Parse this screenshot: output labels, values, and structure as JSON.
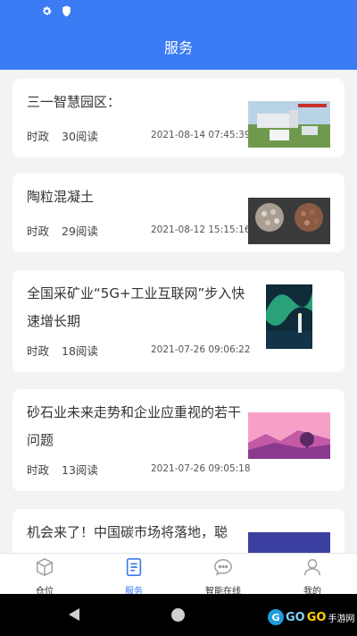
{
  "header": {
    "title": "服务"
  },
  "status_icons": [
    "gear-icon",
    "shield-icon"
  ],
  "articles": [
    {
      "title": "三一智慧园区：",
      "category": "时政",
      "reads": "30阅读",
      "date": "2021-08-14 07:45:39",
      "thumb": "industrial-park-photo"
    },
    {
      "title": "陶粒混凝土",
      "category": "时政",
      "reads": "29阅读",
      "date": "2021-08-12 15:15:16",
      "thumb": "ceramsite-photo"
    },
    {
      "title": "全国采矿业“5G+工业互联网”步入快速增长期",
      "category": "时政",
      "reads": "18阅读",
      "date": "2021-07-26 09:06:22",
      "thumb": "aurora-lighthouse-photo"
    },
    {
      "title": "砂石业未来走势和企业应重视的若干问题",
      "category": "时政",
      "reads": "13阅读",
      "date": "2021-07-26 09:05:18",
      "thumb": "pink-landscape-photo"
    },
    {
      "title": "机会来了！中国碳市场将落地，聪",
      "category": "",
      "reads": "",
      "date": "",
      "thumb": "purple-landscape-photo"
    }
  ],
  "tabbar": {
    "items": [
      {
        "label": "仓位",
        "icon": "box-icon",
        "active": false
      },
      {
        "label": "服务",
        "icon": "document-icon",
        "active": true
      },
      {
        "label": "智能在线",
        "icon": "chat-icon",
        "active": false
      },
      {
        "label": "我的",
        "icon": "user-icon",
        "active": false
      }
    ]
  },
  "colors": {
    "primary": "#3b7bf3",
    "background": "#f2f3f5"
  }
}
